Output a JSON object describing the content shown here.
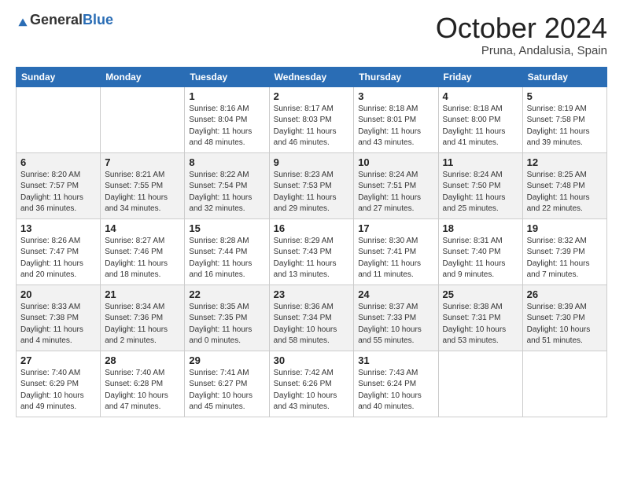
{
  "header": {
    "logo_general": "General",
    "logo_blue": "Blue",
    "month": "October 2024",
    "location": "Pruna, Andalusia, Spain"
  },
  "weekdays": [
    "Sunday",
    "Monday",
    "Tuesday",
    "Wednesday",
    "Thursday",
    "Friday",
    "Saturday"
  ],
  "weeks": [
    [
      {
        "day": "",
        "info": ""
      },
      {
        "day": "",
        "info": ""
      },
      {
        "day": "1",
        "info": "Sunrise: 8:16 AM\nSunset: 8:04 PM\nDaylight: 11 hours and 48 minutes."
      },
      {
        "day": "2",
        "info": "Sunrise: 8:17 AM\nSunset: 8:03 PM\nDaylight: 11 hours and 46 minutes."
      },
      {
        "day": "3",
        "info": "Sunrise: 8:18 AM\nSunset: 8:01 PM\nDaylight: 11 hours and 43 minutes."
      },
      {
        "day": "4",
        "info": "Sunrise: 8:18 AM\nSunset: 8:00 PM\nDaylight: 11 hours and 41 minutes."
      },
      {
        "day": "5",
        "info": "Sunrise: 8:19 AM\nSunset: 7:58 PM\nDaylight: 11 hours and 39 minutes."
      }
    ],
    [
      {
        "day": "6",
        "info": "Sunrise: 8:20 AM\nSunset: 7:57 PM\nDaylight: 11 hours and 36 minutes."
      },
      {
        "day": "7",
        "info": "Sunrise: 8:21 AM\nSunset: 7:55 PM\nDaylight: 11 hours and 34 minutes."
      },
      {
        "day": "8",
        "info": "Sunrise: 8:22 AM\nSunset: 7:54 PM\nDaylight: 11 hours and 32 minutes."
      },
      {
        "day": "9",
        "info": "Sunrise: 8:23 AM\nSunset: 7:53 PM\nDaylight: 11 hours and 29 minutes."
      },
      {
        "day": "10",
        "info": "Sunrise: 8:24 AM\nSunset: 7:51 PM\nDaylight: 11 hours and 27 minutes."
      },
      {
        "day": "11",
        "info": "Sunrise: 8:24 AM\nSunset: 7:50 PM\nDaylight: 11 hours and 25 minutes."
      },
      {
        "day": "12",
        "info": "Sunrise: 8:25 AM\nSunset: 7:48 PM\nDaylight: 11 hours and 22 minutes."
      }
    ],
    [
      {
        "day": "13",
        "info": "Sunrise: 8:26 AM\nSunset: 7:47 PM\nDaylight: 11 hours and 20 minutes."
      },
      {
        "day": "14",
        "info": "Sunrise: 8:27 AM\nSunset: 7:46 PM\nDaylight: 11 hours and 18 minutes."
      },
      {
        "day": "15",
        "info": "Sunrise: 8:28 AM\nSunset: 7:44 PM\nDaylight: 11 hours and 16 minutes."
      },
      {
        "day": "16",
        "info": "Sunrise: 8:29 AM\nSunset: 7:43 PM\nDaylight: 11 hours and 13 minutes."
      },
      {
        "day": "17",
        "info": "Sunrise: 8:30 AM\nSunset: 7:41 PM\nDaylight: 11 hours and 11 minutes."
      },
      {
        "day": "18",
        "info": "Sunrise: 8:31 AM\nSunset: 7:40 PM\nDaylight: 11 hours and 9 minutes."
      },
      {
        "day": "19",
        "info": "Sunrise: 8:32 AM\nSunset: 7:39 PM\nDaylight: 11 hours and 7 minutes."
      }
    ],
    [
      {
        "day": "20",
        "info": "Sunrise: 8:33 AM\nSunset: 7:38 PM\nDaylight: 11 hours and 4 minutes."
      },
      {
        "day": "21",
        "info": "Sunrise: 8:34 AM\nSunset: 7:36 PM\nDaylight: 11 hours and 2 minutes."
      },
      {
        "day": "22",
        "info": "Sunrise: 8:35 AM\nSunset: 7:35 PM\nDaylight: 11 hours and 0 minutes."
      },
      {
        "day": "23",
        "info": "Sunrise: 8:36 AM\nSunset: 7:34 PM\nDaylight: 10 hours and 58 minutes."
      },
      {
        "day": "24",
        "info": "Sunrise: 8:37 AM\nSunset: 7:33 PM\nDaylight: 10 hours and 55 minutes."
      },
      {
        "day": "25",
        "info": "Sunrise: 8:38 AM\nSunset: 7:31 PM\nDaylight: 10 hours and 53 minutes."
      },
      {
        "day": "26",
        "info": "Sunrise: 8:39 AM\nSunset: 7:30 PM\nDaylight: 10 hours and 51 minutes."
      }
    ],
    [
      {
        "day": "27",
        "info": "Sunrise: 7:40 AM\nSunset: 6:29 PM\nDaylight: 10 hours and 49 minutes."
      },
      {
        "day": "28",
        "info": "Sunrise: 7:40 AM\nSunset: 6:28 PM\nDaylight: 10 hours and 47 minutes."
      },
      {
        "day": "29",
        "info": "Sunrise: 7:41 AM\nSunset: 6:27 PM\nDaylight: 10 hours and 45 minutes."
      },
      {
        "day": "30",
        "info": "Sunrise: 7:42 AM\nSunset: 6:26 PM\nDaylight: 10 hours and 43 minutes."
      },
      {
        "day": "31",
        "info": "Sunrise: 7:43 AM\nSunset: 6:24 PM\nDaylight: 10 hours and 40 minutes."
      },
      {
        "day": "",
        "info": ""
      },
      {
        "day": "",
        "info": ""
      }
    ]
  ]
}
